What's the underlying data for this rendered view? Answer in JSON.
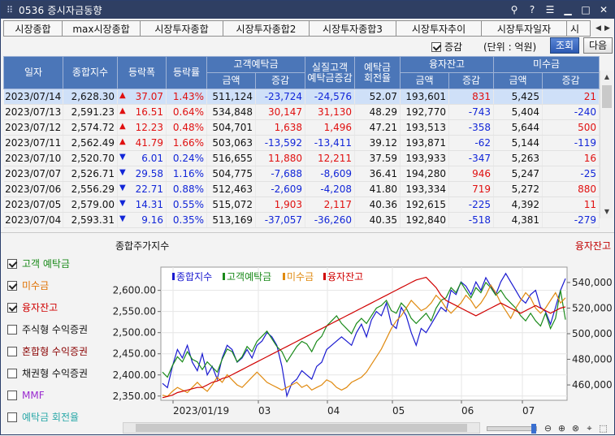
{
  "window": {
    "title": "0536 증시자금동향",
    "help": "?",
    "icons": [
      "pin-icon",
      "help-icon",
      "menu-icon",
      "minimize-icon",
      "maximize-icon",
      "close-icon"
    ]
  },
  "tabs": [
    "시장종합",
    "max시장종합",
    "시장투자종합",
    "시장투자종합2",
    "시장투자종합3",
    "시장투자추이",
    "시장투자일자",
    "시"
  ],
  "options": {
    "change_checkbox_label": "증감",
    "unit_label": "(단위 : 억원)",
    "query_button": "조회",
    "next_button": "다음",
    "change_checked": true
  },
  "table": {
    "headers": {
      "date": "일자",
      "index": "종합지수",
      "change": "등락폭",
      "rate": "등락률",
      "deposit": "고객예탁금",
      "deposit_amt": "금액",
      "deposit_chg": "증감",
      "real_deposit": "실질고객\n예탁금증감",
      "turnover": "예탁금\n회전율",
      "credit": "융자잔고",
      "credit_amt": "금액",
      "credit_chg": "증감",
      "unpaid": "미수금",
      "unpaid_amt": "금액",
      "unpaid_chg": "증감"
    },
    "rows": [
      {
        "date": "2023/07/14",
        "index": "2,628.30",
        "dir": "up",
        "change": "37.07",
        "rate": "1.43%",
        "dep": "511,124",
        "dep_chg": "-23,724",
        "real": "-24,576",
        "turn": "52.07",
        "cr": "193,601",
        "cr_chg": "831",
        "un": "5,425",
        "un_chg": "21",
        "selected": true
      },
      {
        "date": "2023/07/13",
        "index": "2,591.23",
        "dir": "up",
        "change": "16.51",
        "rate": "0.64%",
        "dep": "534,848",
        "dep_chg": "30,147",
        "real": "31,130",
        "turn": "48.29",
        "cr": "192,770",
        "cr_chg": "-743",
        "un": "5,404",
        "un_chg": "-240"
      },
      {
        "date": "2023/07/12",
        "index": "2,574.72",
        "dir": "up",
        "change": "12.23",
        "rate": "0.48%",
        "dep": "504,701",
        "dep_chg": "1,638",
        "real": "1,496",
        "turn": "47.21",
        "cr": "193,513",
        "cr_chg": "-358",
        "un": "5,644",
        "un_chg": "500"
      },
      {
        "date": "2023/07/11",
        "index": "2,562.49",
        "dir": "up",
        "change": "41.79",
        "rate": "1.66%",
        "dep": "503,063",
        "dep_chg": "-13,592",
        "real": "-13,411",
        "turn": "39.12",
        "cr": "193,871",
        "cr_chg": "-62",
        "un": "5,144",
        "un_chg": "-119"
      },
      {
        "date": "2023/07/10",
        "index": "2,520.70",
        "dir": "dn",
        "change": "6.01",
        "rate": "0.24%",
        "dep": "516,655",
        "dep_chg": "11,880",
        "real": "12,211",
        "turn": "37.59",
        "cr": "193,933",
        "cr_chg": "-347",
        "un": "5,263",
        "un_chg": "16"
      },
      {
        "date": "2023/07/07",
        "index": "2,526.71",
        "dir": "dn",
        "change": "29.58",
        "rate": "1.16%",
        "dep": "504,775",
        "dep_chg": "-7,688",
        "real": "-8,609",
        "turn": "36.41",
        "cr": "194,280",
        "cr_chg": "946",
        "un": "5,247",
        "un_chg": "-25"
      },
      {
        "date": "2023/07/06",
        "index": "2,556.29",
        "dir": "dn",
        "change": "22.71",
        "rate": "0.88%",
        "dep": "512,463",
        "dep_chg": "-2,609",
        "real": "-4,208",
        "turn": "41.80",
        "cr": "193,334",
        "cr_chg": "719",
        "un": "5,272",
        "un_chg": "880"
      },
      {
        "date": "2023/07/05",
        "index": "2,579.00",
        "dir": "dn",
        "change": "14.31",
        "rate": "0.55%",
        "dep": "515,072",
        "dep_chg": "1,903",
        "real": "2,117",
        "turn": "40.36",
        "cr": "192,615",
        "cr_chg": "-225",
        "un": "4,392",
        "un_chg": "11"
      },
      {
        "date": "2023/07/04",
        "index": "2,593.31",
        "dir": "dn",
        "change": "9.16",
        "rate": "0.35%",
        "dep": "513,169",
        "dep_chg": "-37,057",
        "real": "-36,260",
        "turn": "40.35",
        "cr": "192,840",
        "cr_chg": "-518",
        "un": "4,381",
        "un_chg": "-279"
      }
    ]
  },
  "legend_panel": [
    {
      "label": "고객 예탁금",
      "checked": true,
      "color": "#1a8a1a"
    },
    {
      "label": "미수금",
      "checked": true,
      "color": "#e07000"
    },
    {
      "label": "융자잔고",
      "checked": true,
      "color": "#d00000"
    },
    {
      "label": "주식형 수익증권",
      "checked": false,
      "color": "#111111"
    },
    {
      "label": "혼합형 수익증권",
      "checked": false,
      "color": "#8a0000"
    },
    {
      "label": "채권형 수익증권",
      "checked": false,
      "color": "#111111"
    },
    {
      "label": "MMF",
      "checked": false,
      "color": "#9a2ad0"
    },
    {
      "label": "예탁금 회전율",
      "checked": false,
      "color": "#2aa8a8"
    }
  ],
  "chart_data": {
    "type": "line",
    "title_left": "종합주가지수",
    "title_right": "융자잔고",
    "legend": [
      {
        "name": "종합지수",
        "color": "#1a1ad0"
      },
      {
        "name": "고객예탁금",
        "color": "#1a8a1a"
      },
      {
        "name": "미수금",
        "color": "#e08a10"
      },
      {
        "name": "융자잔고",
        "color": "#d00000"
      }
    ],
    "x_ticks": [
      "2023/01/19",
      "03",
      "04",
      "05",
      "06",
      "07"
    ],
    "y_left": {
      "ticks": [
        "2,350.00",
        "2,400.00",
        "2,450.00",
        "2,500.00",
        "2,550.00",
        "2,600.00"
      ],
      "min": 2340,
      "max": 2655
    },
    "y_right": {
      "ticks": [
        "460,000",
        "480,000",
        "500,000",
        "520,000",
        "540,000"
      ],
      "min": 448000,
      "max": 552000
    },
    "grid": true,
    "series": [
      {
        "name": "종합지수",
        "axis": "left",
        "color": "#1a1ad0",
        "values": [
          2380,
          2370,
          2420,
          2460,
          2440,
          2470,
          2430,
          2410,
          2450,
          2400,
          2420,
          2390,
          2440,
          2470,
          2460,
          2430,
          2440,
          2460,
          2440,
          2470,
          2480,
          2500,
          2490,
          2470,
          2420,
          2350,
          2380,
          2390,
          2410,
          2400,
          2390,
          2420,
          2430,
          2460,
          2470,
          2480,
          2490,
          2480,
          2470,
          2500,
          2520,
          2490,
          2530,
          2550,
          2540,
          2570,
          2520,
          2510,
          2560,
          2540,
          2500,
          2470,
          2510,
          2500,
          2520,
          2540,
          2560,
          2550,
          2600,
          2590,
          2620,
          2610,
          2590,
          2620,
          2600,
          2630,
          2610,
          2590,
          2620,
          2640,
          2620,
          2600,
          2580,
          2570,
          2590,
          2600,
          2560,
          2550,
          2520,
          2560,
          2600,
          2628
        ]
      },
      {
        "name": "고객예탁금",
        "axis": "right",
        "color": "#1a8a1a",
        "values": [
          470000,
          466000,
          475000,
          482000,
          478000,
          486000,
          480000,
          478000,
          472000,
          478000,
          474000,
          470000,
          480000,
          488000,
          486000,
          478000,
          482000,
          490000,
          486000,
          494000,
          498000,
          502000,
          496000,
          490000,
          486000,
          478000,
          484000,
          490000,
          494000,
          492000,
          486000,
          494000,
          498000,
          506000,
          510000,
          514000,
          508000,
          504000,
          500000,
          508000,
          512000,
          508000,
          514000,
          520000,
          522000,
          526000,
          518000,
          516000,
          524000,
          520000,
          512000,
          508000,
          512000,
          516000,
          510000,
          520000,
          526000,
          528000,
          536000,
          532000,
          540000,
          534000,
          528000,
          536000,
          532000,
          540000,
          536000,
          530000,
          534000,
          528000,
          524000,
          520000,
          514000,
          510000,
          516000,
          510000,
          506000,
          516000,
          504000,
          512000,
          534000,
          511000
        ]
      },
      {
        "name": "미수금",
        "axis": "right",
        "color": "#e08a10",
        "values": [
          452000,
          451000,
          455000,
          458000,
          456000,
          454000,
          458000,
          462000,
          458000,
          455000,
          460000,
          466000,
          462000,
          468000,
          464000,
          460000,
          458000,
          462000,
          466000,
          470000,
          466000,
          462000,
          460000,
          458000,
          456000,
          458000,
          460000,
          462000,
          458000,
          460000,
          456000,
          458000,
          460000,
          464000,
          462000,
          458000,
          456000,
          458000,
          462000,
          464000,
          466000,
          470000,
          476000,
          482000,
          488000,
          496000,
          504000,
          510000,
          514000,
          520000,
          526000,
          522000,
          518000,
          520000,
          524000,
          530000,
          526000,
          520000,
          516000,
          520000,
          524000,
          530000,
          526000,
          520000,
          524000,
          530000,
          538000,
          532000,
          524000,
          518000,
          512000,
          520000,
          526000,
          532000,
          528000,
          520000,
          516000,
          520000,
          526000,
          532000,
          524000,
          528000
        ]
      },
      {
        "name": "융자잔고",
        "axis": "right",
        "color": "#d00000",
        "values": [
          450000,
          451000,
          452000,
          454000,
          455000,
          456000,
          457000,
          458000,
          458000,
          460000,
          462000,
          463000,
          465000,
          466000,
          468000,
          470000,
          472000,
          474000,
          476000,
          478000,
          480000,
          482000,
          484000,
          486000,
          488000,
          490000,
          492000,
          494000,
          496000,
          498000,
          500000,
          502000,
          504000,
          506000,
          508000,
          510000,
          512000,
          514000,
          516000,
          518000,
          520000,
          522000,
          524000,
          526000,
          528000,
          530000,
          532000,
          534000,
          536000,
          538000,
          540000,
          542000,
          543000,
          544000,
          540000,
          536000,
          530000,
          526000,
          524000,
          522000,
          520000,
          518000,
          516000,
          514000,
          516000,
          518000,
          520000,
          522000,
          524000,
          522000,
          520000,
          518000,
          516000,
          518000,
          520000,
          522000,
          520000,
          518000,
          516000,
          518000,
          520000,
          521000
        ]
      }
    ]
  }
}
